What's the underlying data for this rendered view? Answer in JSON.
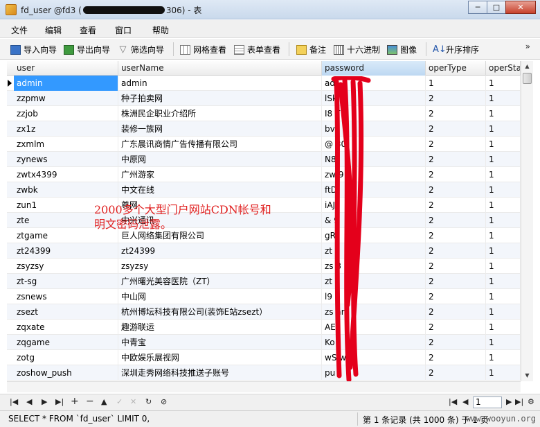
{
  "window": {
    "title_prefix": "fd_user @fd3 (",
    "title_suffix": "306) - 表",
    "buttons": {
      "minimize": "─",
      "maximize": "□",
      "close": "✕"
    }
  },
  "menu": [
    "文件",
    "编辑",
    "查看",
    "窗口",
    "帮助"
  ],
  "toolbar": {
    "import": "导入向导",
    "export": "导出向导",
    "filter": "筛选向导",
    "grid_view": "网格查看",
    "form_view": "表单查看",
    "note": "备注",
    "hex": "十六进制",
    "image": "图像",
    "sort": "升序排序",
    "more": "»"
  },
  "columns": [
    "user",
    "userName",
    "password",
    "operType",
    "operSta"
  ],
  "rows": [
    {
      "user": "admin",
      "userName": "admin",
      "password": "ad",
      "operType": "1",
      "operStatus": "1"
    },
    {
      "user": "zzpmw",
      "userName": "种子拍卖网",
      "password": "lSk     U",
      "operType": "2",
      "operStatus": "1"
    },
    {
      "user": "zzjob",
      "userName": "株洲民企职业介绍所",
      "password": "I8      T",
      "operType": "2",
      "operStatus": "1"
    },
    {
      "user": "zx1z",
      "userName": "装修一族网",
      "password": "bv",
      "operType": "2",
      "operStatus": "1"
    },
    {
      "user": "zxmlm",
      "userName": "广东晨讯商情广告传播有限公司",
      "password": "@       30i",
      "operType": "2",
      "operStatus": "1"
    },
    {
      "user": "zynews",
      "userName": "中原网",
      "password": "N8",
      "operType": "2",
      "operStatus": "1"
    },
    {
      "user": "zwtx4399",
      "userName": "广州游家",
      "password": "zw      9",
      "operType": "2",
      "operStatus": "1"
    },
    {
      "user": "zwbk",
      "userName": "中文在线",
      "password": "ftD",
      "operType": "2",
      "operStatus": "1"
    },
    {
      "user": "zun1",
      "userName": "尊网",
      "password": "iAJ",
      "operType": "2",
      "operStatus": "1"
    },
    {
      "user": "zte",
      "userName": "中兴通讯",
      "password": "&      9",
      "operType": "2",
      "operStatus": "1"
    },
    {
      "user": "ztgame",
      "userName": "巨人网络集团有限公司",
      "password": "gR",
      "operType": "2",
      "operStatus": "1"
    },
    {
      "user": "zt24399",
      "userName": "zt24399",
      "password": "zt",
      "operType": "2",
      "operStatus": "1"
    },
    {
      "user": "zsyzsy",
      "userName": "zsyzsy",
      "password": "zs       3",
      "operType": "2",
      "operStatus": "1"
    },
    {
      "user": "zt-sg",
      "userName": "广州曙光美容医院（ZT）",
      "password": "zt      2",
      "operType": "2",
      "operStatus": "1"
    },
    {
      "user": "zsnews",
      "userName": "中山网",
      "password": "l9",
      "operType": "2",
      "operStatus": "1"
    },
    {
      "user": "zsezt",
      "userName": "杭州博坛科技有限公司(装饰E站zsezt）",
      "password": "zs      ar",
      "operType": "2",
      "operStatus": "1"
    },
    {
      "user": "zqxate",
      "userName": "趣游联运",
      "password": "AE",
      "operType": "2",
      "operStatus": "1"
    },
    {
      "user": "zqgame",
      "userName": "中青宝",
      "password": "Ko",
      "operType": "2",
      "operStatus": "1"
    },
    {
      "user": "zotg",
      "userName": "中欧娱乐展视网",
      "password": "wS      w",
      "operType": "2",
      "operStatus": "1"
    },
    {
      "user": "zoshow_push",
      "userName": "深圳走秀网络科技推送子账号",
      "password": "pu",
      "operType": "2",
      "operStatus": "1"
    }
  ],
  "selected_row": 0,
  "pagination": {
    "page": "1"
  },
  "status": {
    "sql": "SELECT * FROM `fd_user` LIMIT 0,",
    "record": "第 1 条记录 (共 1000 条) 于 1 页",
    "watermark": "www.wooyun.org"
  },
  "annotation": {
    "line1": "2000多个大型门户网站CDN帐号和",
    "line2": "明文密码泄露。"
  },
  "colors": {
    "selection": "#3399ff",
    "annotation": "#e02020",
    "scribble": "#e4001b"
  }
}
